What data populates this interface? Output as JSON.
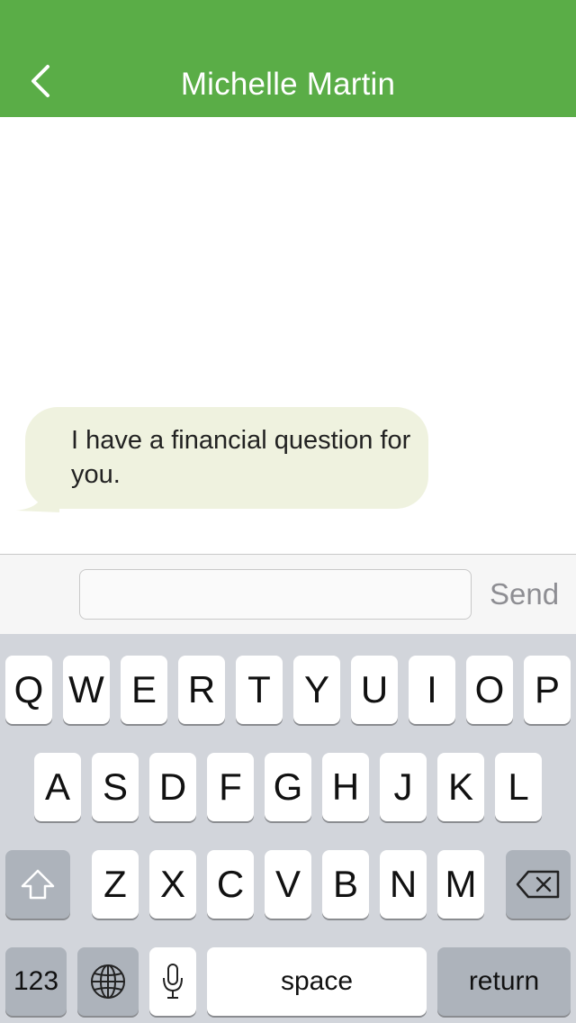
{
  "header": {
    "title": "Michelle Martin",
    "back_icon": "chevron-left-icon",
    "background": "#5aad47"
  },
  "messages": [
    {
      "text": "I have a financial question for you.",
      "direction": "incoming",
      "bubble_color": "#eff2df"
    }
  ],
  "compose": {
    "input_value": "",
    "input_placeholder": "",
    "send_label": "Send"
  },
  "keyboard": {
    "row1": [
      "Q",
      "W",
      "E",
      "R",
      "T",
      "Y",
      "U",
      "I",
      "O",
      "P"
    ],
    "row2": [
      "A",
      "S",
      "D",
      "F",
      "G",
      "H",
      "J",
      "K",
      "L"
    ],
    "row3": [
      "Z",
      "X",
      "C",
      "V",
      "B",
      "N",
      "M"
    ],
    "shift_icon": "shift-icon",
    "backspace_icon": "backspace-icon",
    "numbers_label": "123",
    "globe_icon": "globe-icon",
    "mic_icon": "microphone-icon",
    "space_label": "space",
    "return_label": "return"
  }
}
